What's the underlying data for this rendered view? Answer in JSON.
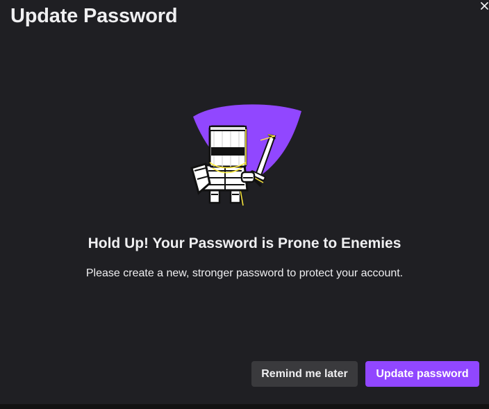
{
  "dialog": {
    "title": "Update Password",
    "close_icon": "close-icon",
    "illustration": "knight-mascot-illustration",
    "heading": "Hold Up! Your Password is Prone to Enemies",
    "message": "Please create a new, stronger password to protect your account.",
    "buttons": {
      "remind_later": "Remind me later",
      "update_password": "Update password"
    }
  },
  "colors": {
    "background": "#1f1f23",
    "accent": "#9147ff",
    "secondary_button": "#3a3a3d",
    "text": "#efeff1"
  }
}
